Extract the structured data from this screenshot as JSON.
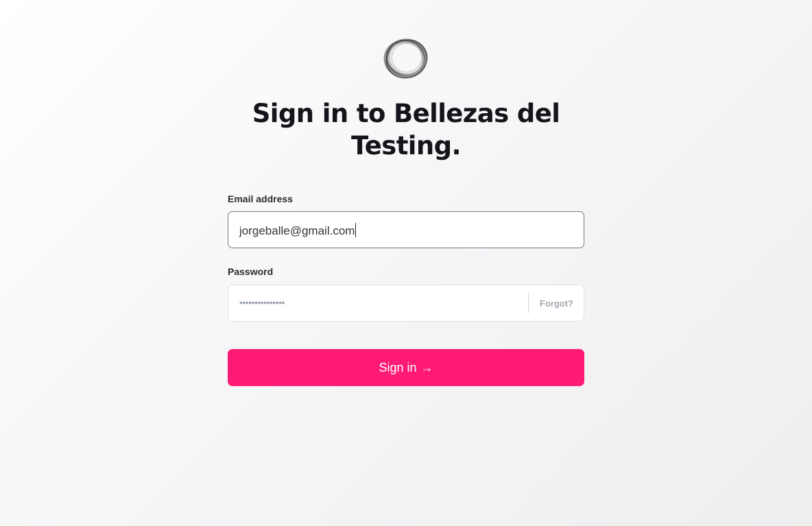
{
  "app": {
    "logo": "circle-logo-icon",
    "title": "Sign in to Bellezas del Testing."
  },
  "form": {
    "email": {
      "label": "Email address",
      "value": "jorgeballe@gmail.com"
    },
    "password": {
      "label": "Password",
      "masked_value": "•••••••••••••••",
      "forgot_label": "Forgot?"
    },
    "submit": {
      "label": "Sign in",
      "icon": "arrow-right-icon",
      "arrow": "→"
    }
  },
  "colors": {
    "accent": "#ff1a75",
    "text": "#14141a",
    "muted": "#a3a9b2"
  }
}
